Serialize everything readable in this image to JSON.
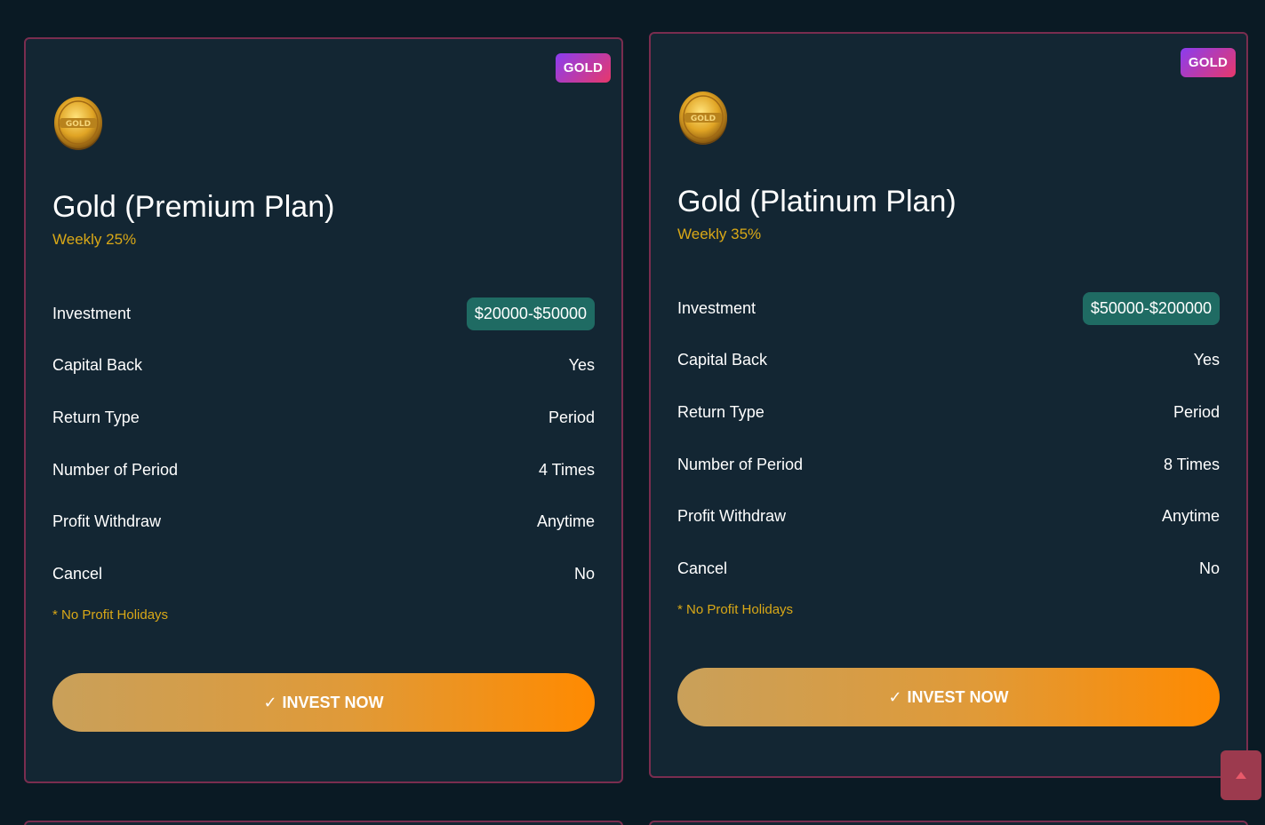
{
  "plans": [
    {
      "badge": "GOLD",
      "coin_label": "GOLD",
      "title": "Gold (Premium Plan)",
      "subtitle": "Weekly 25%",
      "rows": [
        {
          "label": "Investment",
          "value": "$20000-$50000"
        },
        {
          "label": "Capital Back",
          "value": "Yes"
        },
        {
          "label": "Return Type",
          "value": "Period"
        },
        {
          "label": "Number of Period",
          "value": "4 Times"
        },
        {
          "label": "Profit Withdraw",
          "value": "Anytime"
        },
        {
          "label": "Cancel",
          "value": "No"
        }
      ],
      "note": "* No Profit Holidays",
      "button_icon": "✓",
      "button_label": "INVEST NOW"
    },
    {
      "badge": "GOLD",
      "coin_label": "GOLD",
      "title": "Gold (Platinum Plan)",
      "subtitle": "Weekly 35%",
      "rows": [
        {
          "label": "Investment",
          "value": "$50000-$200000"
        },
        {
          "label": "Capital Back",
          "value": "Yes"
        },
        {
          "label": "Return Type",
          "value": "Period"
        },
        {
          "label": "Number of Period",
          "value": "8 Times"
        },
        {
          "label": "Profit Withdraw",
          "value": "Anytime"
        },
        {
          "label": "Cancel",
          "value": "No"
        }
      ],
      "note": "* No Profit Holidays",
      "button_icon": "✓",
      "button_label": "INVEST NOW"
    }
  ],
  "scroll_top_icon": "arrow-up-icon",
  "colors": {
    "background": "#0a1a24",
    "card": "#132633",
    "card_border": "#7a2d4f",
    "accent_gold": "#d9a817",
    "pill": "#1f6b63",
    "button_start": "#c9a05a",
    "button_end": "#ff8a00"
  }
}
